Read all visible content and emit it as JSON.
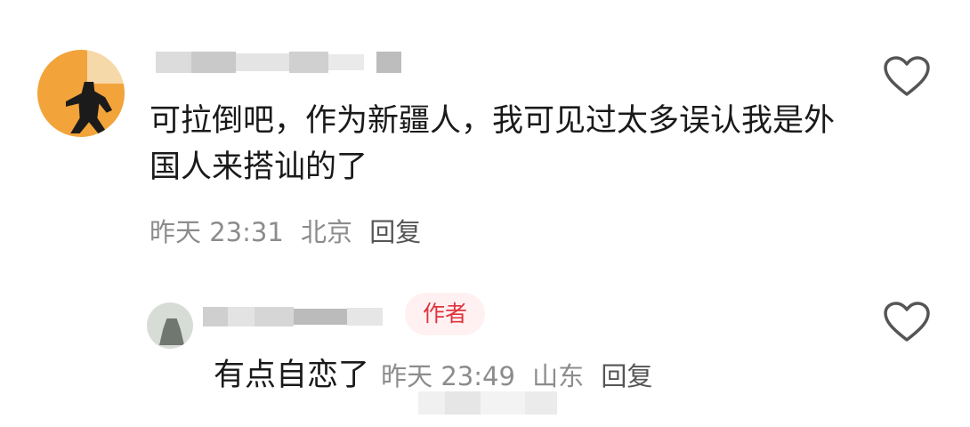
{
  "comment": {
    "text": "可拉倒吧，作为新疆人，我可见过太多误认我是外国人来搭讪的了",
    "time": "昨天 23:31",
    "location": "北京",
    "reply_label": "回复"
  },
  "reply": {
    "badge": "作者",
    "text": "有点自恋了",
    "time": "昨天 23:49",
    "location": "山东",
    "reply_label": "回复"
  },
  "icons": {
    "like": "heart-outline-icon"
  },
  "colors": {
    "badge_text": "#e0333c",
    "badge_bg": "#fff1f2",
    "avatar_main": "#f2a33a"
  }
}
